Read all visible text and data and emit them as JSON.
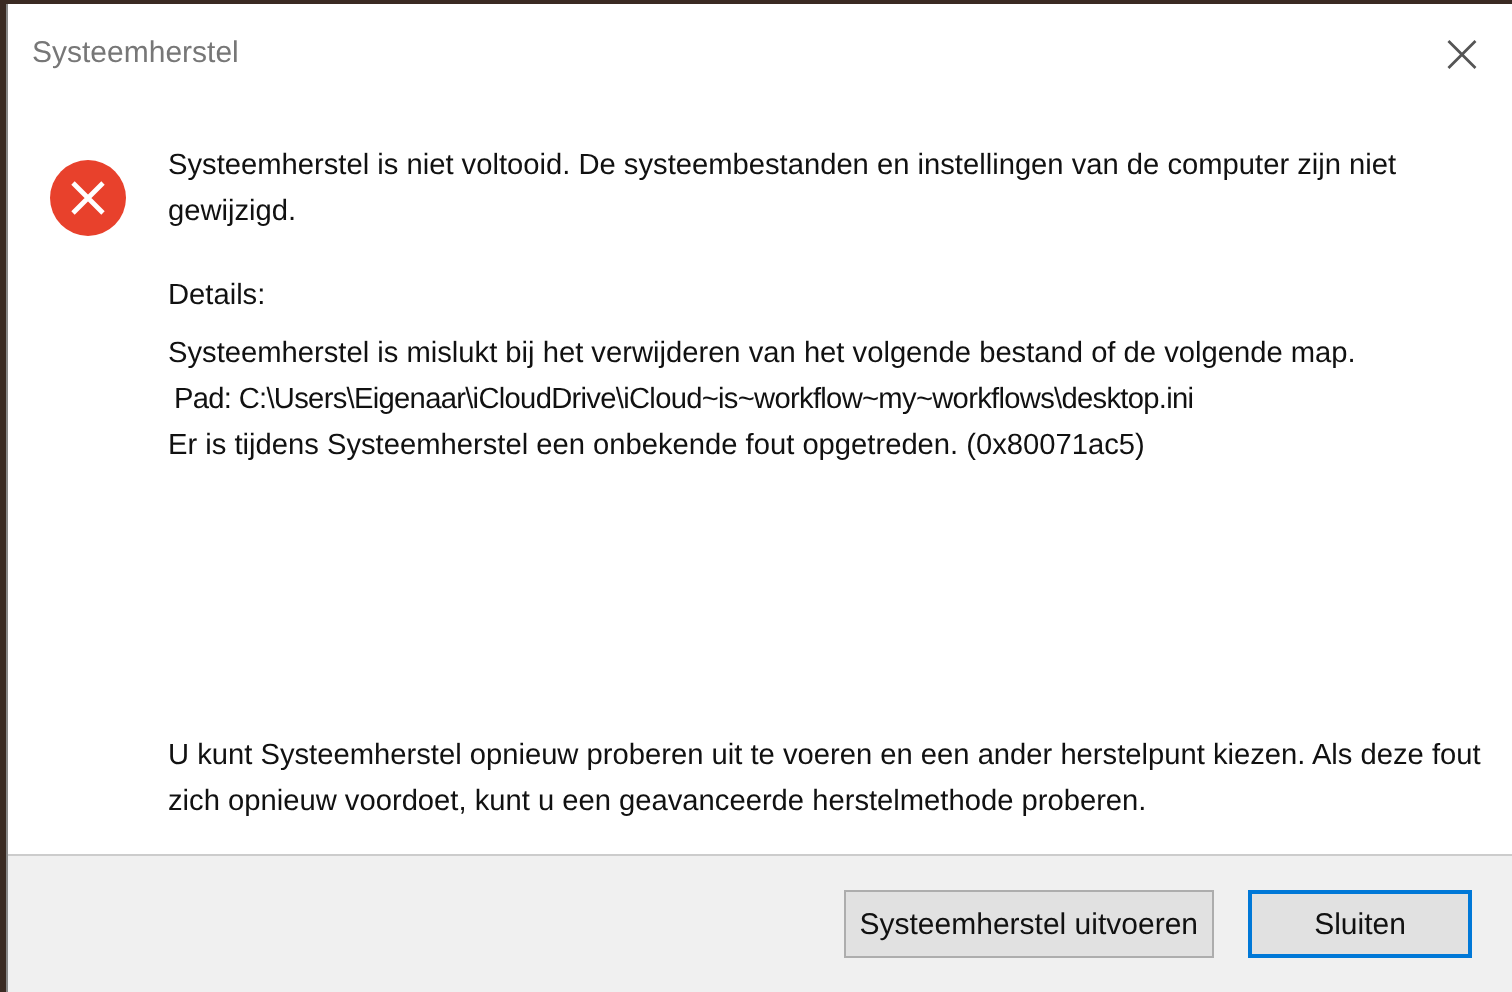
{
  "window": {
    "title": "Systeemherstel",
    "close": "×"
  },
  "message": "Systeemherstel is niet voltooid. De systeembestanden en instellingen van de computer zijn niet gewijzigd.",
  "details": {
    "heading": "Details:",
    "lines": [
      "Systeemherstel is mislukt bij het verwijderen van het volgende bestand of de volgende map.",
      "Pad: C:\\Users\\Eigenaar\\iCloudDrive\\iCloud~is~workflow~my~workflows\\desktop.ini",
      "Er is tijdens Systeemherstel een onbekende fout opgetreden. (0x80071ac5)"
    ]
  },
  "advice": "U kunt Systeemherstel opnieuw proberen uit te voeren en een ander herstelpunt kiezen. Als deze fout zich opnieuw voordoet, kunt u een geavanceerde herstelmethode proberen.",
  "buttons": [
    {
      "label": "Systeemherstel uitvoeren",
      "default": false
    },
    {
      "label": "Sluiten",
      "default": true
    }
  ]
}
